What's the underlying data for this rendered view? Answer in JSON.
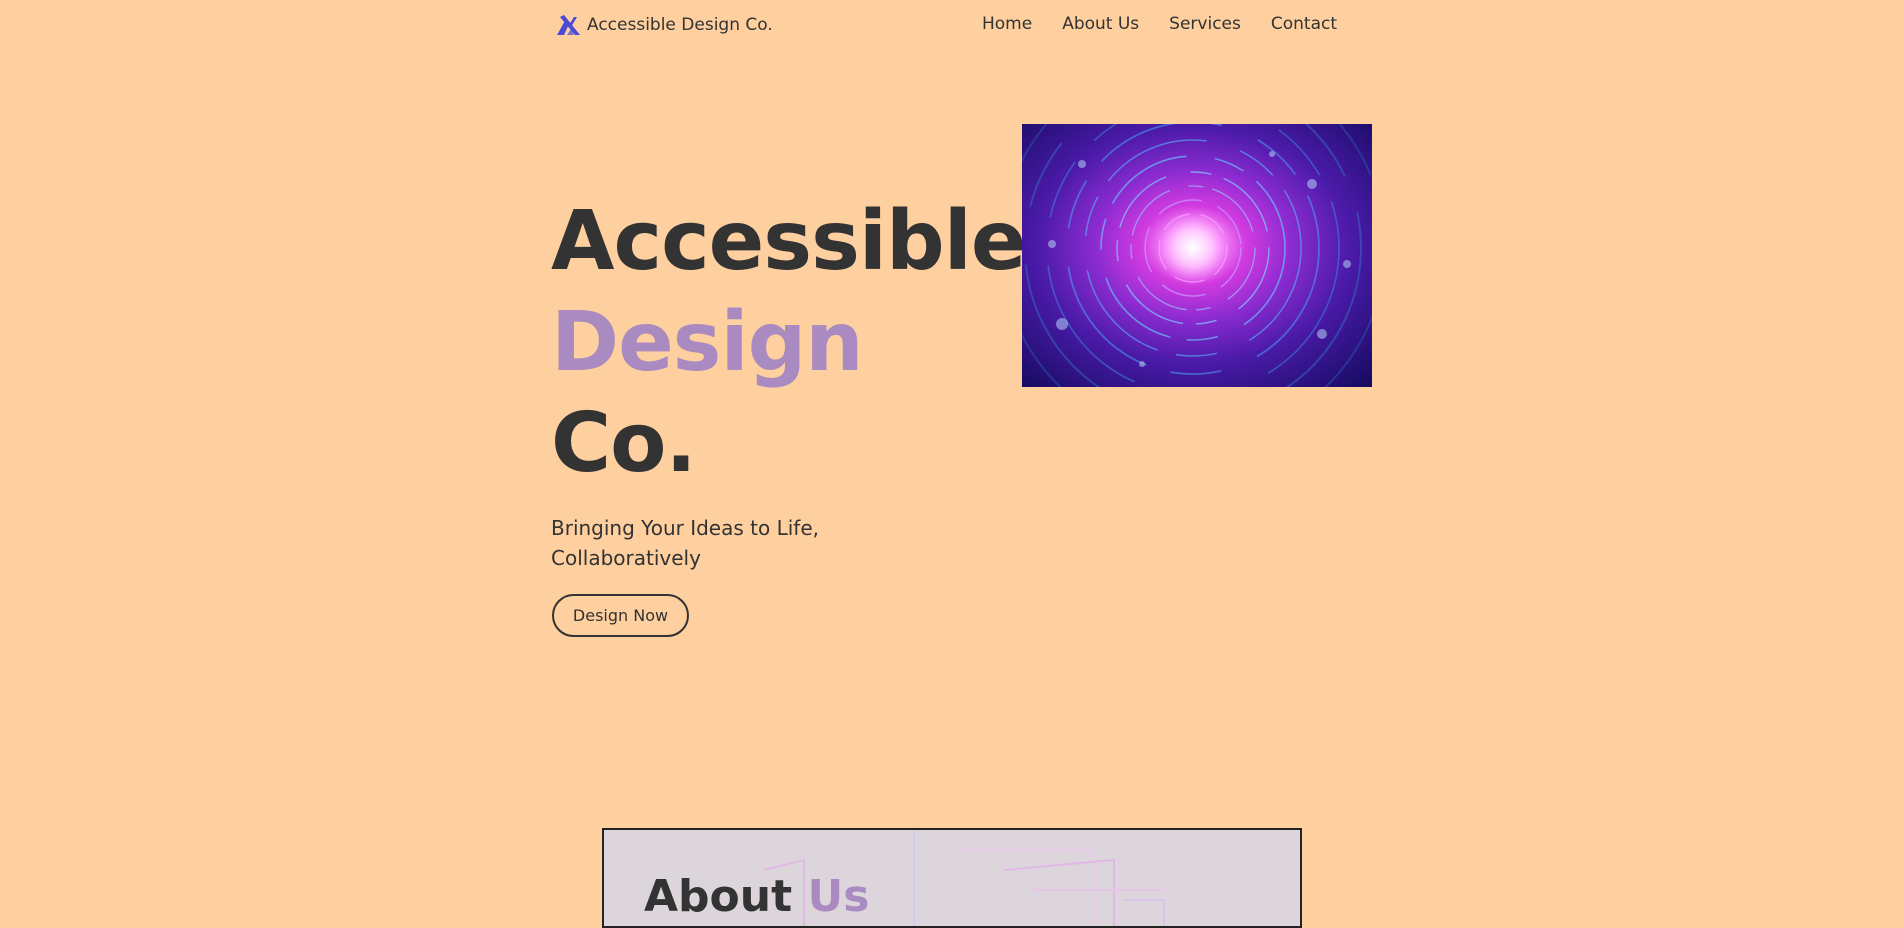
{
  "header": {
    "brand_name": "Accessible Design Co.",
    "logo_icon": "triangle-x-logo-icon",
    "nav": [
      {
        "label": "Home"
      },
      {
        "label": "About Us"
      },
      {
        "label": "Services"
      },
      {
        "label": "Contact"
      }
    ]
  },
  "hero": {
    "title_line1": "Accessible",
    "title_line2": "Design",
    "title_line3": "Co.",
    "subtitle": "Bringing Your Ideas to Life, Collaboratively",
    "cta_label": "Design Now",
    "image_subject": "purple-swirl-tunnel"
  },
  "about": {
    "title_part1": "About",
    "title_part2": "Us"
  },
  "colors": {
    "background": "#fecf9f",
    "text": "#333333",
    "accent": "#a98bc1",
    "logo": "#4a4ad6"
  }
}
